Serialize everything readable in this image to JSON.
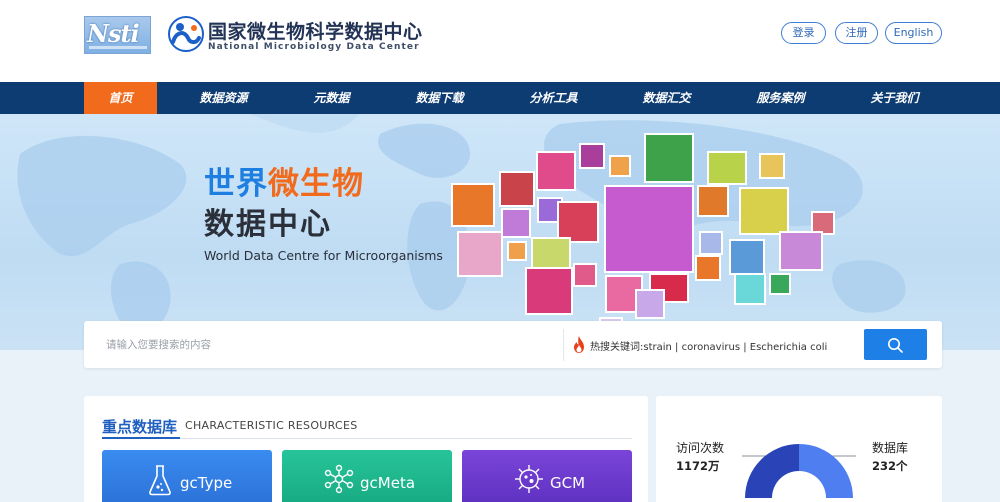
{
  "header": {
    "logo_nsti_text": "Nsti",
    "title_cn": "国家微生物科学数据中心",
    "title_en": "National Microbiology Data Center",
    "login_label": "登录",
    "register_label": "注册",
    "english_label": "English"
  },
  "nav": {
    "items": [
      {
        "label": "首页",
        "active": true
      },
      {
        "label": "数据资源"
      },
      {
        "label": "元数据"
      },
      {
        "label": "数据下载"
      },
      {
        "label": "分析工具"
      },
      {
        "label": "数据汇交"
      },
      {
        "label": "服务案例"
      },
      {
        "label": "关于我们"
      }
    ]
  },
  "hero": {
    "title_part1": "世界",
    "title_part2": "微生物",
    "title_line2": "数据中心",
    "subtitle": "World Data Centre for Microorganisms"
  },
  "search": {
    "placeholder": "请输入您要搜索的内容",
    "hot_keywords_label": "热搜关键词:",
    "hot_keywords": "strain | coronavirus | Escherichia coli"
  },
  "resources": {
    "title_cn": "重点数据库",
    "title_en": "CHARACTERISTIC RESOURCES",
    "cards": [
      {
        "label": "gcType",
        "icon": "flask-icon",
        "color": "#2f7ee6"
      },
      {
        "label": "gcMeta",
        "icon": "network-icon",
        "color": "#1db88d"
      },
      {
        "label": "GCM",
        "icon": "microbe-icon",
        "color": "#6a3ad0"
      }
    ]
  },
  "stats": {
    "visits_label": "访问次数",
    "visits_value": "1172万",
    "databases_label": "数据库",
    "databases_value": "232个"
  },
  "colors": {
    "nav_bg": "#0d3c73",
    "nav_active": "#f26a1b",
    "primary_blue": "#1e7fe6",
    "accent_orange": "#f26a1b"
  }
}
